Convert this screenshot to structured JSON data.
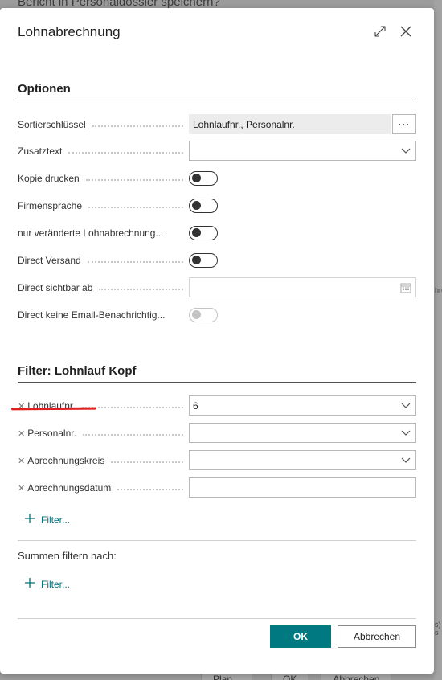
{
  "background": {
    "title": "Bericht in Personaldossier speichern?",
    "buttons": [
      "Plan...",
      "OK",
      "Abbrechen"
    ],
    "edge_text_1": "hre",
    "edge_text_2": "s) s"
  },
  "dialog": {
    "title": "Lohnabrechnung",
    "expand_icon": "expand-icon",
    "close_icon": "close-icon"
  },
  "optionen": {
    "title": "Optionen",
    "fields": {
      "sortierschluessel": {
        "label": "Sortierschlüssel",
        "value": "Lohnlaufnr., Personalnr.",
        "assist": "···"
      },
      "zusatztext": {
        "label": "Zusatztext",
        "value": ""
      },
      "kopie_drucken": {
        "label": "Kopie drucken",
        "value": false
      },
      "firmensprache": {
        "label": "Firmensprache",
        "value": false
      },
      "nur_veraenderte": {
        "label": "nur veränderte Lohnabrechnung...",
        "value": false
      },
      "direct_versand": {
        "label": "Direct Versand",
        "value": false
      },
      "direct_sichtbar_ab": {
        "label": "Direct sichtbar ab",
        "value": ""
      },
      "direct_keine_email": {
        "label": "Direct keine Email-Benachrichtig...",
        "value": false
      }
    }
  },
  "filter_kopf": {
    "title": "Filter: Lohnlauf Kopf",
    "fields": {
      "lohnlaufnr": {
        "label": "Lohnlaufnr.",
        "value": "6"
      },
      "personalnr": {
        "label": "Personalnr.",
        "value": ""
      },
      "abrechnungskreis": {
        "label": "Abrechnungskreis",
        "value": ""
      },
      "abrechnungsdatum": {
        "label": "Abrechnungsdatum",
        "value": ""
      }
    },
    "add_filter_label": "Filter..."
  },
  "summen": {
    "label": "Summen filtern nach:",
    "add_filter_label": "Filter..."
  },
  "footer": {
    "ok_label": "OK",
    "cancel_label": "Abbrechen"
  },
  "colors": {
    "accent": "#007a80",
    "link": "#00737a",
    "annotation_red": "#e0201e"
  }
}
